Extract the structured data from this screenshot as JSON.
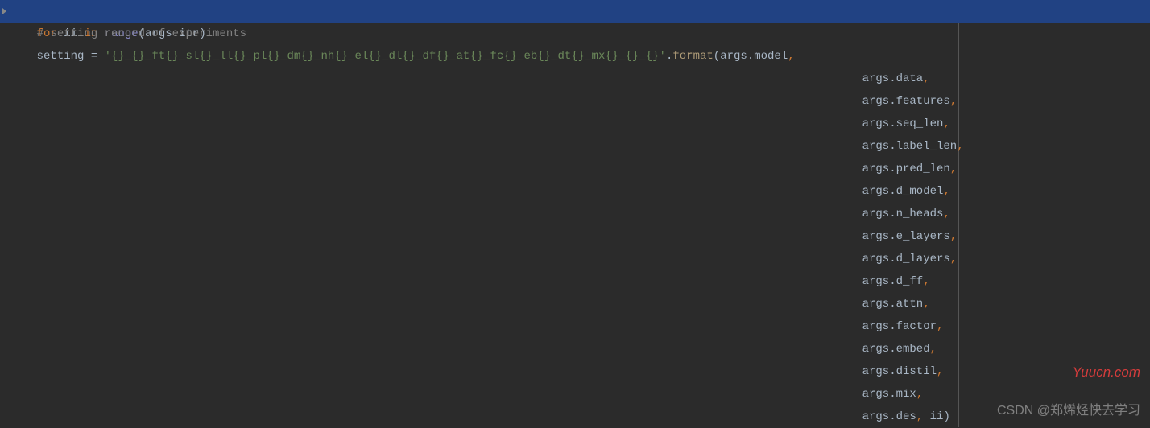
{
  "code": {
    "line1": {
      "kw_for": "for",
      "var": "ii",
      "kw_in": "in",
      "builtin_range": "range",
      "lparen": "(",
      "expr_args": "args",
      "dot": ".",
      "attr_itr": "itr",
      "rparen_colon": "):"
    },
    "line2": {
      "indent": "    ",
      "comment": "# setting record of experiments"
    },
    "line3": {
      "indent": "    ",
      "var_setting": "setting",
      "eq": " = ",
      "str_fmt": "'{}_{}_ft{}_sl{}_ll{}_pl{}_dm{}_nh{}_el{}_dl{}_df{}_at{}_fc{}_eb{}_dt{}_mx{}_{}_{}'",
      "dot": ".",
      "method_format": "format",
      "lparen": "(",
      "arg_args": "args",
      "arg_dot": ".",
      "attr": "model",
      "comma": ","
    },
    "args_list": [
      {
        "obj": "args",
        "attr": "data"
      },
      {
        "obj": "args",
        "attr": "features"
      },
      {
        "obj": "args",
        "attr": "seq_len"
      },
      {
        "obj": "args",
        "attr": "label_len"
      },
      {
        "obj": "args",
        "attr": "pred_len"
      },
      {
        "obj": "args",
        "attr": "d_model"
      },
      {
        "obj": "args",
        "attr": "n_heads"
      },
      {
        "obj": "args",
        "attr": "e_layers"
      },
      {
        "obj": "args",
        "attr": "d_layers"
      },
      {
        "obj": "args",
        "attr": "d_ff"
      },
      {
        "obj": "args",
        "attr": "attn"
      },
      {
        "obj": "args",
        "attr": "factor"
      },
      {
        "obj": "args",
        "attr": "embed"
      },
      {
        "obj": "args",
        "attr": "distil"
      },
      {
        "obj": "args",
        "attr": "mix"
      }
    ],
    "last_line": {
      "obj": "args",
      "attr": "des",
      "sep": ", ",
      "last_arg": "ii",
      "rparen": ")"
    },
    "arg_indent": "                                                                                                                              "
  },
  "watermarks": {
    "csdn": "CSDN @郑烯烃快去学习",
    "yuucn": "Yuucn.com"
  }
}
